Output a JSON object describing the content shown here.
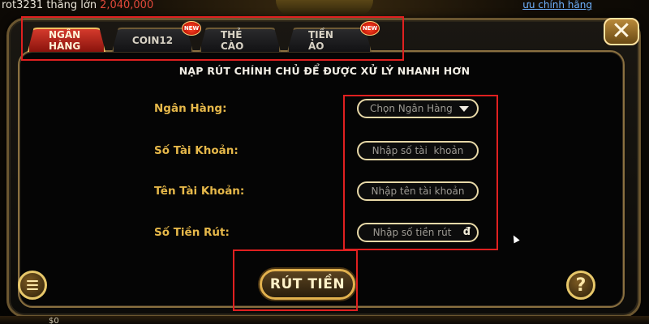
{
  "background": {
    "ticker_user": "rot3231 thắng lớn",
    "ticker_amount": "2,040,000",
    "top_right_link": "ưu chính hãng",
    "bottom_amount": "$0"
  },
  "tabs": [
    {
      "label": "NGÂN HÀNG",
      "active": true,
      "is_new": false
    },
    {
      "label": "COIN12",
      "active": false,
      "is_new": true
    },
    {
      "label": "THẺ CÀO",
      "active": false,
      "is_new": false
    },
    {
      "label": "TIỀN ẢO",
      "active": false,
      "is_new": true
    }
  ],
  "new_badge_text": "NEW",
  "close_icon": "✕",
  "notice": "NẠP RÚT CHÍNH CHỦ ĐỂ ĐƯỢC XỬ LÝ NHANH HƠN",
  "form": {
    "bank_label": "Ngân Hàng:",
    "bank_select_value": "Chọn Ngân Hàng",
    "account_number_label": "Số Tài Khoản:",
    "account_number_placeholder": "Nhập số tài  khoản",
    "account_name_label": "Tên Tài Khoản:",
    "account_name_placeholder": "Nhập tên tài khoản",
    "amount_label": "Số Tiền Rút:",
    "amount_placeholder": "Nhập số tiền rút",
    "currency_symbol": "đ"
  },
  "submit_label": "RÚT TIỀN",
  "help_label": "?",
  "colors": {
    "accent_gold": "#e6b84a",
    "active_tab_red": "#d43a2c",
    "annotation_red": "#e02020"
  }
}
